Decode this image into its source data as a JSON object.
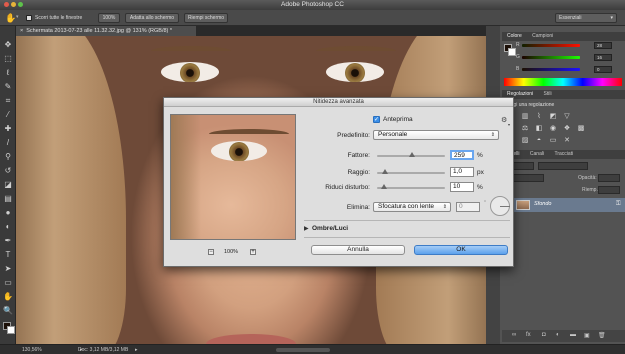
{
  "app": {
    "title": "Adobe Photoshop CC"
  },
  "options_bar": {
    "scroll_all_windows": "Scorri tutte le finestre",
    "zoom_button": "100%",
    "fit_screen_button": "Adatta allo schermo",
    "fill_screen_button": "Riempi schermo",
    "workspace": "Essenziali"
  },
  "document": {
    "tab_title": "Schermata 2013-07-23 alle 11.32.32.jpg @ 131% (RGB/8) *"
  },
  "status_bar": {
    "zoom": "130,56%",
    "doc_size": "Doc: 3,12 MB/3,12 MB"
  },
  "color_panel": {
    "tabs": [
      "Colore",
      "Campioni"
    ],
    "channels": [
      {
        "label": "R",
        "value": "28",
        "color": "#e03030"
      },
      {
        "label": "G",
        "value": "16",
        "color": "#30b030"
      },
      {
        "label": "B",
        "value": "0",
        "color": "#3050e0"
      }
    ]
  },
  "adjustments_panel": {
    "tabs": [
      "Regolazioni",
      "Stili"
    ],
    "subtitle": "giungi una regolazione"
  },
  "layers_panel": {
    "tabs": [
      "Livelli",
      "Canali",
      "Tracciati"
    ],
    "opacity_label": "Opacità:",
    "fill_label": "Riemp.:",
    "layer_name": "Sfondo"
  },
  "dialog": {
    "title": "Nitidezza avanzata",
    "preview_checkbox": "Anteprima",
    "preview_checked": true,
    "preview_zoom": "100%",
    "preset_label": "Predefinito:",
    "preset_value": "Personale",
    "amount_label": "Fattore:",
    "amount_value": "259",
    "amount_unit": "%",
    "amount_fraction": 0.52,
    "radius_label": "Raggio:",
    "radius_value": "1,0",
    "radius_unit": "px",
    "radius_fraction": 0.12,
    "noise_label": "Riduci disturbo:",
    "noise_value": "10",
    "noise_unit": "%",
    "noise_fraction": 0.1,
    "remove_label": "Elimina:",
    "remove_value": "Sfocatura con lente",
    "angle_value": "0",
    "angle_unit": "°",
    "shadows_section": "Ombre/Luci",
    "cancel_button": "Annulla",
    "ok_button": "OK"
  }
}
